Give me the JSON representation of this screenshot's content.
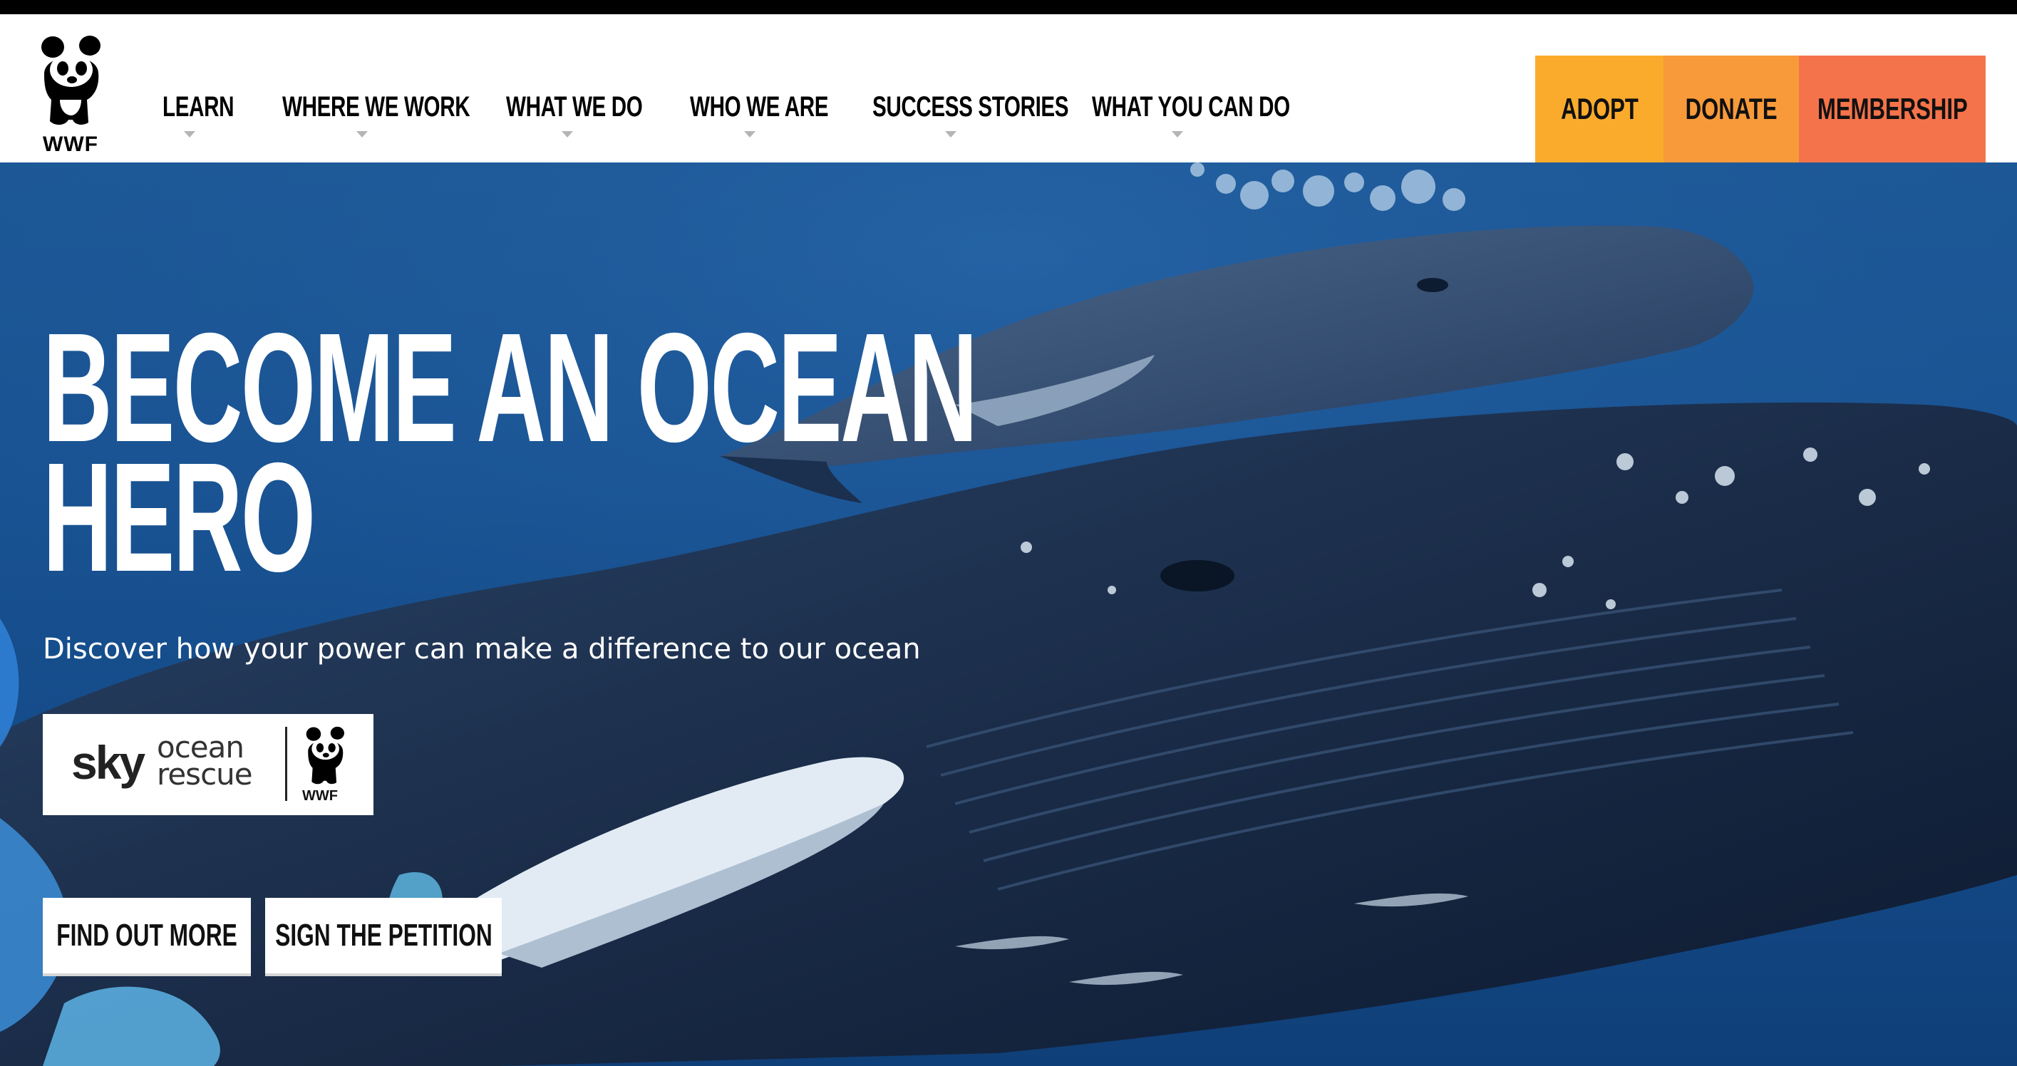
{
  "brand": {
    "logo_text": "WWF",
    "icon": "panda-logo-icon"
  },
  "nav": {
    "items": [
      {
        "label": "LEARN"
      },
      {
        "label": "WHERE WE WORK"
      },
      {
        "label": "WHAT WE DO"
      },
      {
        "label": "WHO WE ARE"
      },
      {
        "label": "SUCCESS STORIES"
      },
      {
        "label": "WHAT YOU CAN DO"
      }
    ]
  },
  "cta": {
    "adopt": "ADOPT",
    "donate": "DONATE",
    "membership": "MEMBERSHIP",
    "colors": {
      "adopt": "#fbab2c",
      "donate": "#f89a3a",
      "membership": "#f5734a"
    }
  },
  "hero": {
    "headline_line1": "BECOME AN OCEAN",
    "headline_line2": "HERO",
    "subtitle": "Discover how your power can make a difference to our ocean",
    "partner": {
      "sky": "sky",
      "ocean": "ocean",
      "rescue": "rescue",
      "wwf": "WWF"
    },
    "buttons": {
      "find_out_more": "FIND OUT MORE",
      "sign_petition": "SIGN THE PETITION"
    }
  }
}
